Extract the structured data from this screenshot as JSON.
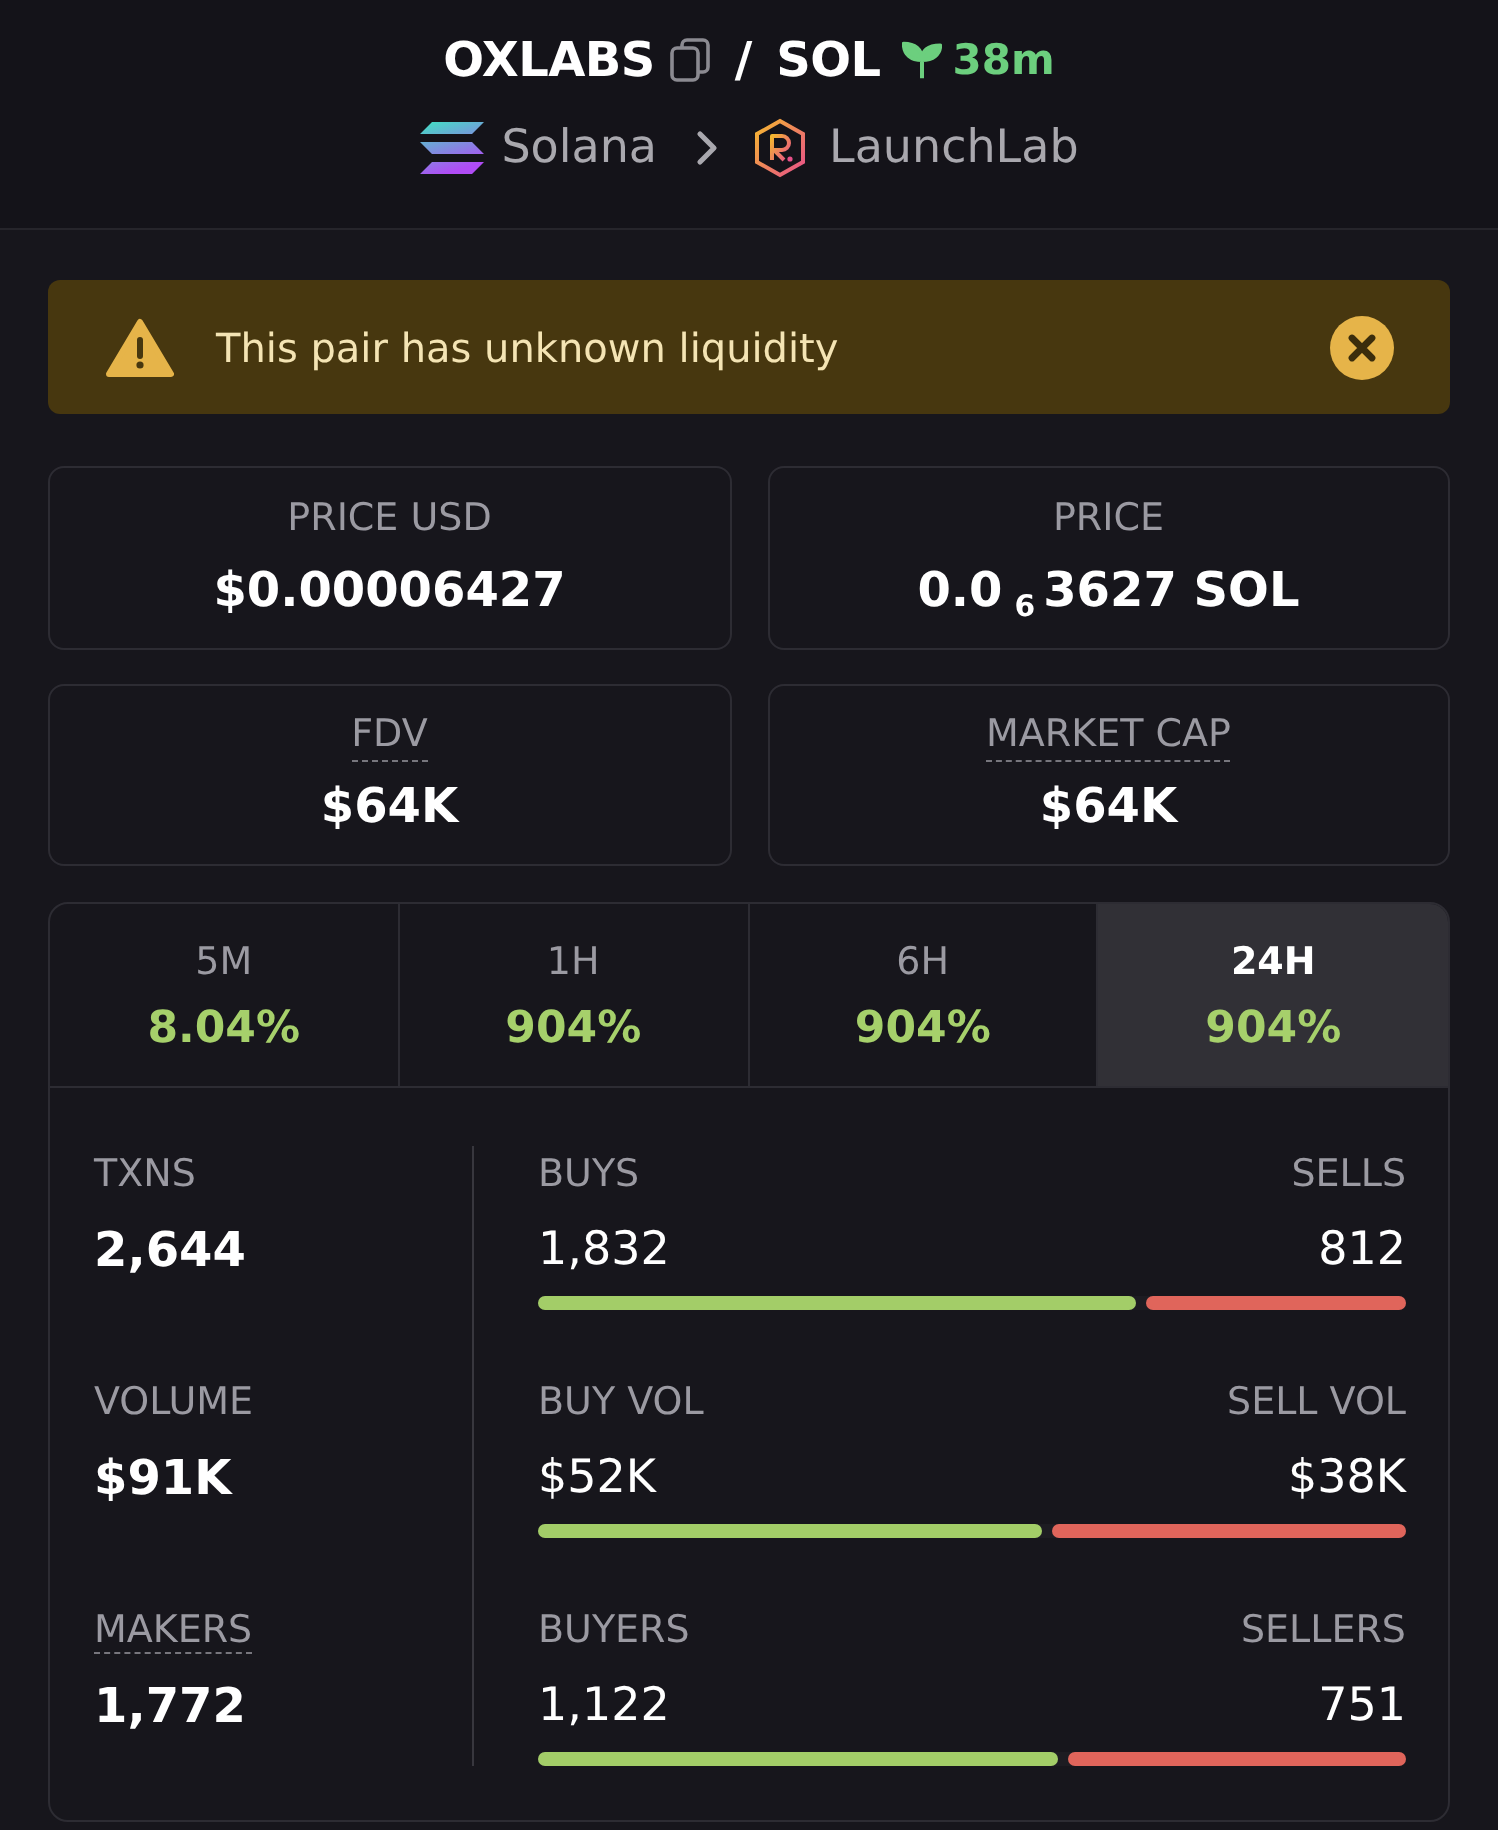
{
  "header": {
    "token": "OXLABS",
    "separator": "/",
    "quote": "SOL",
    "age": "38m",
    "chain": "Solana",
    "dex": "LaunchLab"
  },
  "alert": {
    "text": "This pair has unknown liquidity"
  },
  "stats": [
    {
      "label": "PRICE USD",
      "value": "$0.00006427",
      "underlined": false
    },
    {
      "label": "PRICE",
      "value": "0.0$_{6}$3627 SOL",
      "underlined": false
    },
    {
      "label": "FDV",
      "value": "$64K",
      "underlined": true
    },
    {
      "label": "MARKET CAP",
      "value": "$64K",
      "underlined": true
    }
  ],
  "timeframes": [
    {
      "label": "5M",
      "change": "8.04%",
      "positive": true,
      "selected": false
    },
    {
      "label": "1H",
      "change": "904%",
      "positive": true,
      "selected": false
    },
    {
      "label": "6H",
      "change": "904%",
      "positive": true,
      "selected": false
    },
    {
      "label": "24H",
      "change": "904%",
      "positive": true,
      "selected": true
    }
  ],
  "summary": [
    {
      "label": "TXNS",
      "value": "2,644",
      "underlined": false
    },
    {
      "label": "VOLUME",
      "value": "$91K",
      "underlined": false
    },
    {
      "label": "MAKERS",
      "value": "1,772",
      "underlined": true
    }
  ],
  "splits": [
    {
      "buy_label": "BUYS",
      "buy_value": "1,832",
      "sell_label": "SELLS",
      "sell_value": "812",
      "level": 0.69
    },
    {
      "buy_label": "BUY VOL",
      "buy_value": "$52K",
      "sell_label": "SELL VOL",
      "sell_value": "$38K",
      "level": 0.58
    },
    {
      "buy_label": "BUYERS",
      "buy_value": "1,122",
      "sell_label": "SELLERS",
      "sell_value": "751",
      "level": 0.6
    }
  ]
}
